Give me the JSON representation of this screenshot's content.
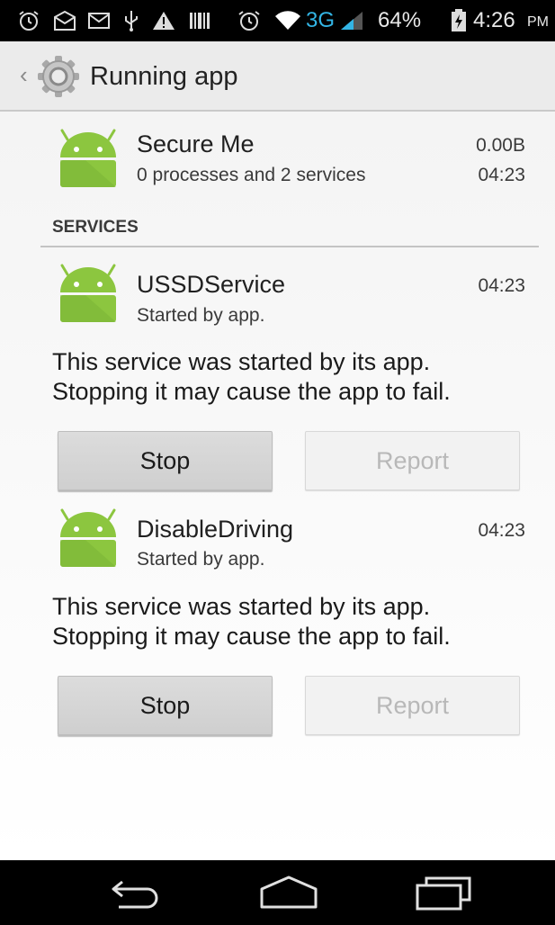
{
  "status_bar": {
    "network": "3G",
    "battery": "64%",
    "time": "4:26",
    "ampm": "PM"
  },
  "action_bar": {
    "title": "Running app",
    "icons": {
      "back": "chevron-left-icon",
      "app": "settings-gear-icon"
    }
  },
  "app": {
    "name": "Secure Me",
    "summary": "0 processes and 2 services",
    "size": "0.00B",
    "time": "04:23"
  },
  "services_header": "SERVICES",
  "services": [
    {
      "name": "USSDService",
      "subtitle": "Started by app.",
      "time": "04:23",
      "description_line1": "This service was started by its app.",
      "description_line2": "Stopping it may cause the app to fail.",
      "stop_label": "Stop",
      "report_label": "Report"
    },
    {
      "name": "DisableDriving",
      "subtitle": "Started by app.",
      "time": "04:23",
      "description_line1": "This service was started by its app.",
      "description_line2": "Stopping it may cause the app to fail.",
      "stop_label": "Stop",
      "report_label": "Report"
    }
  ],
  "nav_bar": {
    "icons": [
      "back-icon",
      "home-icon",
      "recents-icon"
    ]
  },
  "colors": {
    "accent": "#33b5e5",
    "android_green": "#8cc63f"
  }
}
